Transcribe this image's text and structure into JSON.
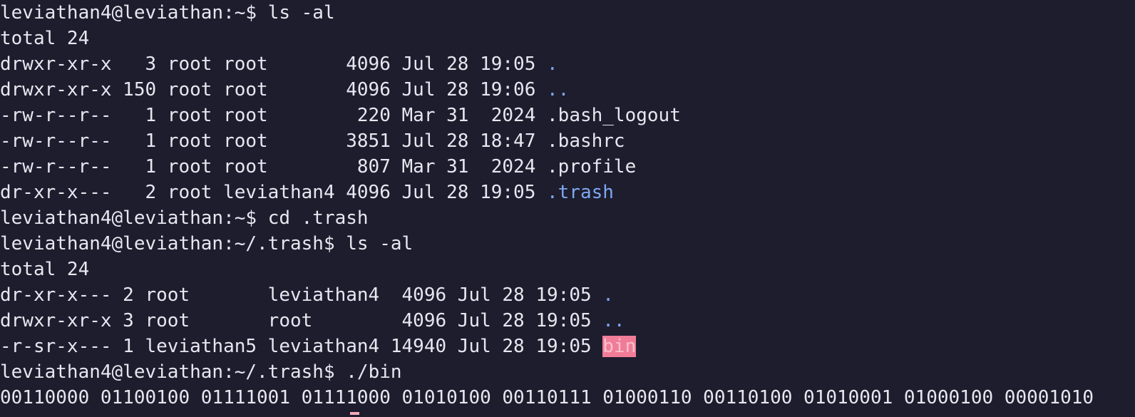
{
  "terminal": {
    "lines": [
      {
        "type": "prompt",
        "prompt": "leviathan4@leviathan:~$ ",
        "command": "ls -al"
      },
      {
        "type": "text",
        "text": "total 24"
      },
      {
        "type": "listing",
        "meta": "drwxr-xr-x   3 root root       4096 Jul 28 19:05 ",
        "name": ".",
        "style": "dir"
      },
      {
        "type": "listing",
        "meta": "drwxr-xr-x 150 root root       4096 Jul 28 19:06 ",
        "name": "..",
        "style": "dir"
      },
      {
        "type": "listing",
        "meta": "-rw-r--r--   1 root root        220 Mar 31  2024 ",
        "name": ".bash_logout",
        "style": "plain"
      },
      {
        "type": "listing",
        "meta": "-rw-r--r--   1 root root       3851 Jul 28 18:47 ",
        "name": ".bashrc",
        "style": "plain"
      },
      {
        "type": "listing",
        "meta": "-rw-r--r--   1 root root        807 Mar 31  2024 ",
        "name": ".profile",
        "style": "plain"
      },
      {
        "type": "listing",
        "meta": "dr-xr-x---   2 root leviathan4 4096 Jul 28 19:05 ",
        "name": ".trash",
        "style": "dir"
      },
      {
        "type": "prompt",
        "prompt": "leviathan4@leviathan:~$ ",
        "command": "cd .trash"
      },
      {
        "type": "prompt",
        "prompt": "leviathan4@leviathan:~/.trash$ ",
        "command": "ls -al"
      },
      {
        "type": "text",
        "text": "total 24"
      },
      {
        "type": "listing",
        "meta": "dr-xr-x--- 2 root       leviathan4  4096 Jul 28 19:05 ",
        "name": ".",
        "style": "dir"
      },
      {
        "type": "listing",
        "meta": "drwxr-xr-x 3 root       root        4096 Jul 28 19:05 ",
        "name": "..",
        "style": "dir"
      },
      {
        "type": "listing",
        "meta": "-r-sr-x--- 1 leviathan5 leviathan4 14940 Jul 28 19:05 ",
        "name": "bin",
        "style": "exec-highlight"
      },
      {
        "type": "prompt",
        "prompt": "leviathan4@leviathan:~/.trash$ ",
        "command": "./bin"
      },
      {
        "type": "text",
        "text": "00110000 01100100 01111001 01111000 01010100 00110111 01000110 00110100 01010001 01000100 00001010"
      }
    ]
  },
  "colors": {
    "background": "#1d1d2e",
    "foreground": "#e6e8ef",
    "directory": "#7fa7f0",
    "setuid_highlight_bg": "#f07c98",
    "setuid_highlight_fg": "#f7c0cd"
  }
}
